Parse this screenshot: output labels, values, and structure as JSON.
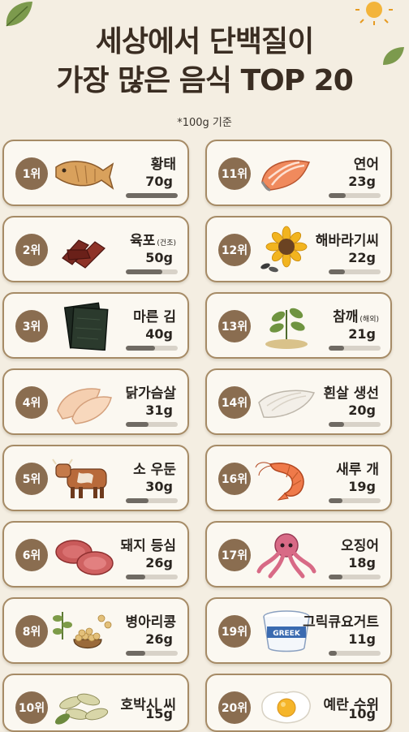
{
  "title_line1": "세상에서 단백질이",
  "title_line2": "가장 많은 음식 TOP 20",
  "subtitle": "*100g 기준",
  "colors": {
    "background": "#f4eee2",
    "card_border": "#a68b66",
    "rank_badge": "#8a6d50",
    "bar_fill": "#6f6a63"
  },
  "items": [
    {
      "rank": "1위",
      "name": "황태",
      "note": "",
      "amount": "70g",
      "fraction": 1.0,
      "icon": "dried-pollack-icon"
    },
    {
      "rank": "11위",
      "name": "연어",
      "note": "",
      "amount": "23g",
      "fraction": 0.33,
      "icon": "salmon-icon"
    },
    {
      "rank": "2위",
      "name": "육포",
      "note": "(건조)",
      "amount": "50g",
      "fraction": 0.71,
      "icon": "beef-jerky-icon"
    },
    {
      "rank": "12위",
      "name": "해바라기씨",
      "note": "",
      "amount": "22g",
      "fraction": 0.31,
      "icon": "sunflower-seeds-icon"
    },
    {
      "rank": "3위",
      "name": "마른 김",
      "note": "",
      "amount": "40g",
      "fraction": 0.57,
      "icon": "dried-seaweed-icon"
    },
    {
      "rank": "13위",
      "name": "참깨",
      "note": "(해외)",
      "amount": "21g",
      "fraction": 0.3,
      "icon": "sesame-icon"
    },
    {
      "rank": "4위",
      "name": "닭가슴살",
      "note": "",
      "amount": "31g",
      "fraction": 0.44,
      "icon": "chicken-breast-icon"
    },
    {
      "rank": "14위",
      "name": "흰살 생선",
      "note": "",
      "amount": "20g",
      "fraction": 0.29,
      "icon": "white-fish-icon"
    },
    {
      "rank": "5위",
      "name": "소 우둔",
      "note": "",
      "amount": "30g",
      "fraction": 0.43,
      "icon": "cow-icon"
    },
    {
      "rank": "16위",
      "name": "새루 개",
      "note": "",
      "amount": "19g",
      "fraction": 0.27,
      "icon": "shrimp-icon"
    },
    {
      "rank": "6위",
      "name": "돼지 등심",
      "note": "",
      "amount": "26g",
      "fraction": 0.37,
      "icon": "pork-loin-icon"
    },
    {
      "rank": "17위",
      "name": "오징어",
      "note": "",
      "amount": "18g",
      "fraction": 0.26,
      "icon": "squid-icon"
    },
    {
      "rank": "8위",
      "name": "병아리콩",
      "note": "",
      "amount": "26g",
      "fraction": 0.37,
      "icon": "chickpea-icon"
    },
    {
      "rank": "19위",
      "name": "그릭큐요거트",
      "note": "",
      "amount": "11g",
      "fraction": 0.16,
      "icon": "yogurt-icon",
      "label": "GREEK"
    },
    {
      "rank": "10위",
      "name": "호박시 씨",
      "note": "",
      "amount": "15g",
      "fraction": 0.21,
      "icon": "pumpkin-seeds-icon"
    },
    {
      "rank": "20위",
      "name": "예란 수위",
      "note": "",
      "amount": "10g",
      "fraction": 0.14,
      "icon": "fried-egg-icon"
    }
  ]
}
